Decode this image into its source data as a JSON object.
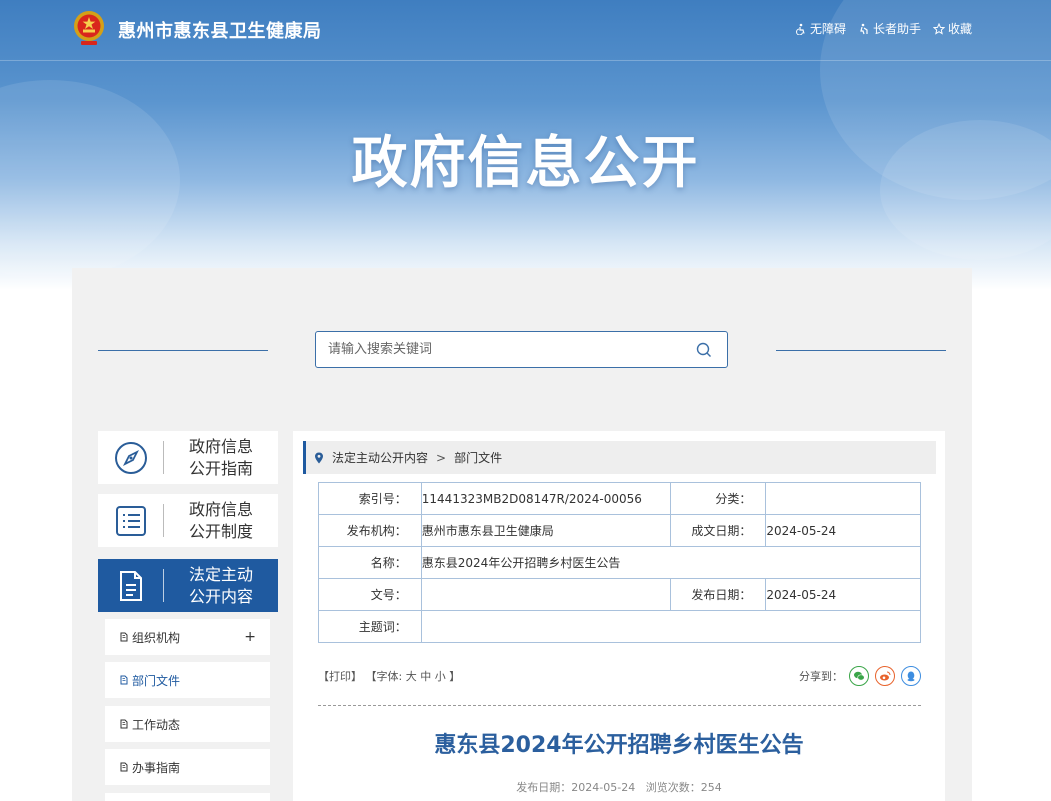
{
  "header": {
    "site_title": "惠州市惠东县卫生健康局",
    "tools": [
      {
        "label": "无障碍",
        "icon": "accessibility-icon"
      },
      {
        "label": "长者助手",
        "icon": "elder-helper-icon"
      },
      {
        "label": "收藏",
        "icon": "star-icon"
      }
    ],
    "hero_title": "政府信息公开"
  },
  "search": {
    "placeholder": "请输入搜索关键词"
  },
  "sidebar": {
    "cards": [
      {
        "line1": "政府信息",
        "line2": "公开指南",
        "icon": "compass-icon"
      },
      {
        "line1": "政府信息",
        "line2": "公开制度",
        "icon": "list-icon"
      },
      {
        "line1": "法定主动",
        "line2": "公开内容",
        "icon": "document-icon",
        "active": true
      }
    ],
    "sub_items": [
      {
        "label": "组织机构",
        "expand": "+"
      },
      {
        "label": "部门文件",
        "selected": true
      },
      {
        "label": "工作动态"
      },
      {
        "label": "办事指南"
      }
    ]
  },
  "breadcrumb": {
    "items": [
      "法定主动公开内容",
      "部门文件"
    ],
    "separator": ">"
  },
  "meta": {
    "index_label": "索引号：",
    "index_value": "11441323MB2D08147R/2024-00056",
    "category_label": "分类：",
    "category_value": "",
    "publisher_label": "发布机构：",
    "publisher_value": "惠州市惠东县卫生健康局",
    "created_label": "成文日期：",
    "created_value": "2024-05-24",
    "name_label": "名称：",
    "name_value": "惠东县2024年公开招聘乡村医生公告",
    "docno_label": "文号：",
    "docno_value": "",
    "published_label": "发布日期：",
    "published_value": "2024-05-24",
    "keywords_label": "主题词：",
    "keywords_value": ""
  },
  "toolbar": {
    "print": "【打印】",
    "font_prefix": "【字体:",
    "font_large": "大",
    "font_medium": "中",
    "font_small": "小",
    "font_suffix": "】",
    "share_label": "分享到：",
    "share_buttons": [
      {
        "name": "wechat",
        "color": "#3aa548"
      },
      {
        "name": "weibo",
        "color": "#e8632c"
      },
      {
        "name": "qq",
        "color": "#3d8de0"
      }
    ]
  },
  "article": {
    "title": "惠东县2024年公开招聘乡村医生公告",
    "date_label": "发布日期：",
    "date_value": "2024-05-24",
    "views_label": "浏览次数：",
    "views_value": "254"
  },
  "colors": {
    "primary": "#1f5aa0",
    "title_blue": "#2b5f9e",
    "table_border": "#a9c1dc"
  }
}
